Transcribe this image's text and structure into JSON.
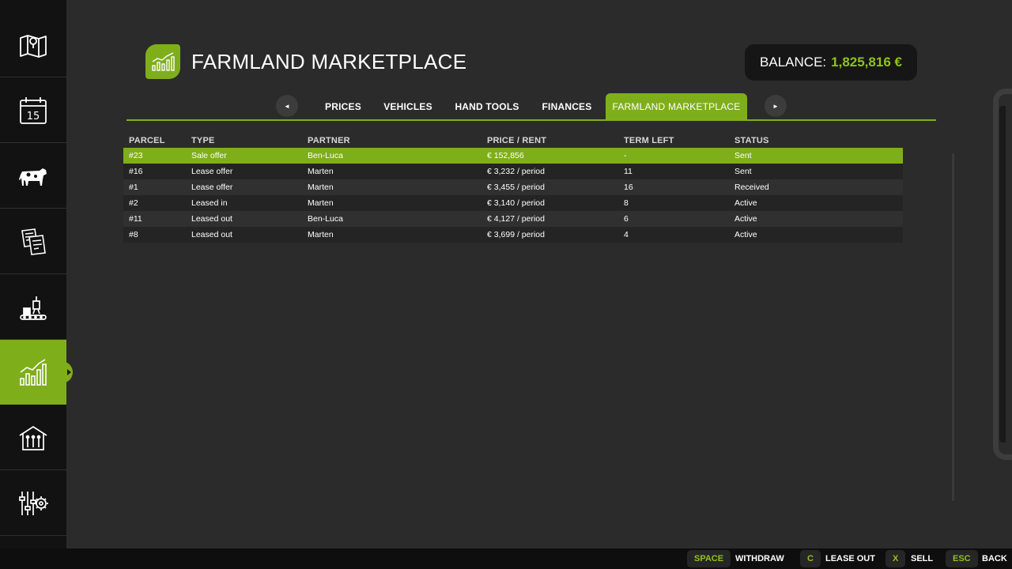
{
  "colors": {
    "accent": "#7fae1b",
    "balance_green": "#8fc21e",
    "background": "#2b2b2b",
    "sidebar": "#121212"
  },
  "sidebar": {
    "items": [
      {
        "icon": "map-icon"
      },
      {
        "icon": "calendar-icon",
        "text": "15"
      },
      {
        "icon": "cow-icon"
      },
      {
        "icon": "contracts-icon"
      },
      {
        "icon": "production-icon"
      },
      {
        "icon": "stats-chart-icon",
        "active": true
      },
      {
        "icon": "barn-icon"
      },
      {
        "icon": "settings-icon"
      }
    ]
  },
  "header": {
    "title": "FARMLAND MARKETPLACE",
    "balance_label": "BALANCE:",
    "balance_value": "1,825,816 €"
  },
  "tabs": {
    "prev_arrow": "◄",
    "next_arrow": "►",
    "items": [
      {
        "label": "PRICES"
      },
      {
        "label": "VEHICLES"
      },
      {
        "label": "HAND TOOLS"
      },
      {
        "label": "FINANCES"
      },
      {
        "label": "FARMLAND MARKETPLACE",
        "active": true
      }
    ]
  },
  "table": {
    "columns": [
      "PARCEL",
      "TYPE",
      "PARTNER",
      "PRICE / RENT",
      "TERM LEFT",
      "STATUS"
    ],
    "rows": [
      {
        "parcel": "#23",
        "type": "Sale offer",
        "partner": "Ben-Luca",
        "price": "€ 152,856",
        "term": "-",
        "status": "Sent",
        "selected": true
      },
      {
        "parcel": "#16",
        "type": "Lease offer",
        "partner": "Marten",
        "price": "€ 3,232 / period",
        "term": "11",
        "status": "Sent"
      },
      {
        "parcel": "#1",
        "type": "Lease offer",
        "partner": "Marten",
        "price": "€ 3,455 / period",
        "term": "16",
        "status": "Received"
      },
      {
        "parcel": "#2",
        "type": "Leased in",
        "partner": "Marten",
        "price": "€ 3,140 / period",
        "term": "8",
        "status": "Active"
      },
      {
        "parcel": "#11",
        "type": "Leased out",
        "partner": "Ben-Luca",
        "price": "€ 4,127 / period",
        "term": "6",
        "status": "Active"
      },
      {
        "parcel": "#8",
        "type": "Leased out",
        "partner": "Marten",
        "price": "€ 3,699 / period",
        "term": "4",
        "status": "Active"
      }
    ]
  },
  "actions": [
    {
      "key": "SPACE",
      "label": "WITHDRAW"
    },
    {
      "key": "C",
      "label": "LEASE OUT"
    },
    {
      "key": "X",
      "label": "SELL"
    },
    {
      "key": "ESC",
      "label": "BACK"
    }
  ]
}
